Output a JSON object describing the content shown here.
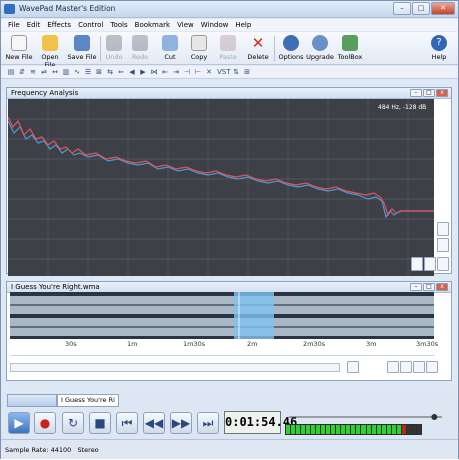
{
  "window": {
    "title": "WavePad Master's Edition"
  },
  "menu": [
    "File",
    "Edit",
    "Effects",
    "Control",
    "Tools",
    "Bookmark",
    "View",
    "Window",
    "Help"
  ],
  "toolbar": {
    "new_file": "New File",
    "open_file": "Open File",
    "save_file": "Save File",
    "undo": "Undo",
    "redo": "Redo",
    "cut": "Cut",
    "copy": "Copy",
    "paste": "Paste",
    "delete": "Delete",
    "options": "Options",
    "upgrade": "Upgrade",
    "toolbox": "ToolBox",
    "help": "Help"
  },
  "freq_panel": {
    "title": "Frequency Analysis",
    "readout": "484 Hz, -128 dB"
  },
  "wave_panel": {
    "title": "I Guess You're Right.wma",
    "ruler": [
      "30s",
      "1m",
      "1m30s",
      "2m",
      "2m30s",
      "3m",
      "3m30s"
    ]
  },
  "tabs": {
    "file_tab": "I Guess You're Ri"
  },
  "transport": {
    "time": "0:01:54.46",
    "volume_fraction": 0.95
  },
  "status": {
    "sample_rate": "Sample Rate: 44100",
    "channels": "Stereo"
  },
  "colors": {
    "spectrum_red": "#e4535a",
    "spectrum_blue": "#4d97d6",
    "selection": "#7fc3f0",
    "wave": "#a9b8c4"
  }
}
